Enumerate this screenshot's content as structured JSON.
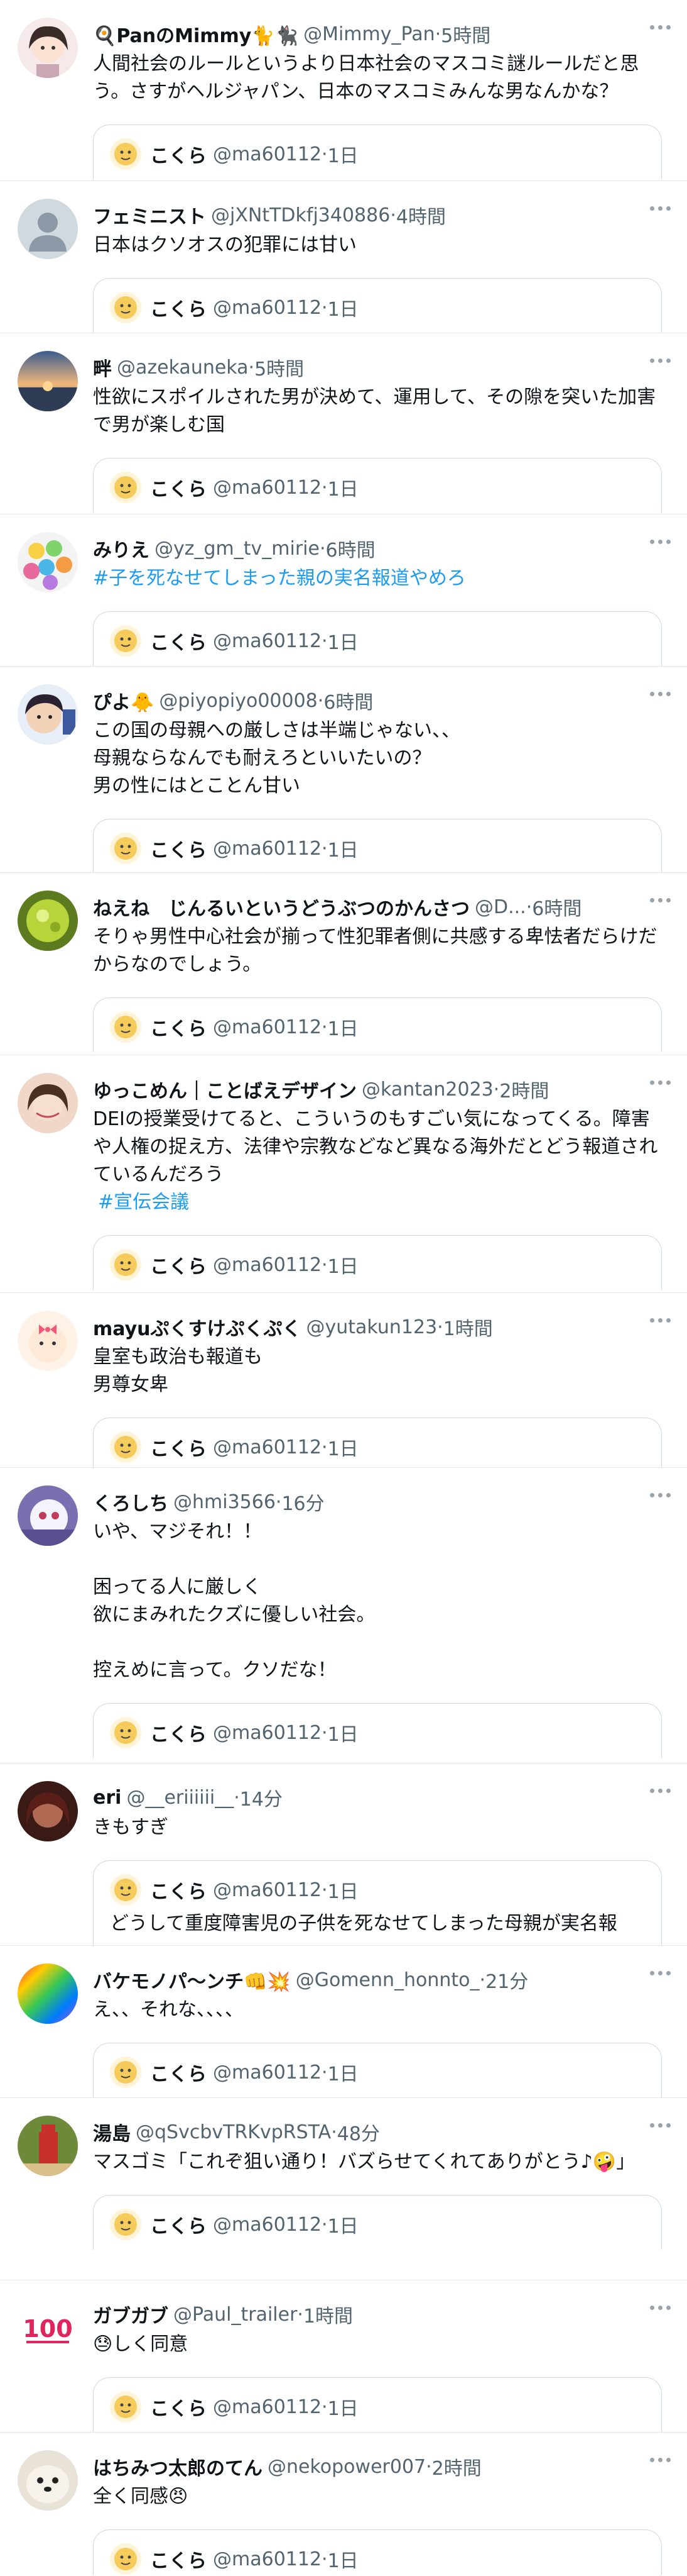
{
  "quoted": {
    "name": "こくら",
    "handle": "@ma60112",
    "time": "1日"
  },
  "tweets": [
    {
      "name": "🍳PanのMimmy🐈🐈‍⬛",
      "handle": "@Mimmy_Pan",
      "time": "5時間",
      "text": "人間社会のルールというより日本社会のマスコミ謎ルールだと思う。さすがヘルジャパン、日本のマスコミみんな男なんかな？"
    },
    {
      "name": "フェミニスト",
      "handle": "@jXNtTDkfj340886",
      "time": "4時間",
      "text": "日本はクソオスの犯罪には甘い"
    },
    {
      "name": "畔",
      "handle": "@azekauneka",
      "time": "5時間",
      "text": "性欲にスポイルされた男が決めて、運用して、その隙を突いた加害で男が楽しむ国"
    },
    {
      "name": "みりえ",
      "handle": "@yz_gm_tv_mirie",
      "time": "6時間",
      "hashtag": "#子を死なせてしまった親の実名報道やめろ"
    },
    {
      "name": "ぴよ🐥",
      "handle": "@piyopiyo00008",
      "time": "6時間",
      "text": "この国の母親への厳しさは半端じゃない、、\n母親ならなんでも耐えろといいたいの？\n男の性にはとことん甘い"
    },
    {
      "name": "ねえね　じんるいというどうぶつのかんさつ",
      "handle": "@D...",
      "time": "6時間",
      "text": "そりゃ男性中心社会が揃って性犯罪者側に共感する卑怯者だらけだからなのでしょう。"
    },
    {
      "name": "ゆっこめん｜ことばえデザイン",
      "handle": "@kantan2023",
      "time": "2時間",
      "text": "DEIの授業受けてると、こういうのもすごい気になってくる。障害や人権の捉え方、法律や宗教などなど異なる海外だとどう報道されているんだろう",
      "hashtag": "#宣伝会議"
    },
    {
      "name": "mayuぷくすけぷくぷく",
      "handle": "@yutakun123",
      "time": "1時間",
      "text": "皇室も政治も報道も\n男尊女卑"
    },
    {
      "name": "くろしち",
      "handle": "@hmi3566",
      "time": "16分",
      "text": "いや、マジそれ！！\n\n困ってる人に厳しく\n欲にまみれたクズに優しい社会。\n\n控えめに言って。クソだな！"
    },
    {
      "name": "eri",
      "handle": "@__eriiiiii__",
      "time": "14分",
      "text": "きもすぎ",
      "quote_text": "どうして重度障害児の子供を死なせてしまった母親が実名報"
    },
    {
      "name": "バケモノパ〜ンチ👊💥",
      "handle": "@Gomenn_honnto_",
      "time": "21分",
      "text": "え、、それな、、、、"
    },
    {
      "name": "湯島",
      "handle": "@qSvcbvTRKvpRSTA",
      "time": "48分",
      "text": "マスゴミ「これぞ狙い通り！バズらせてくれてありがとう♪🤪」"
    },
    {
      "name": "ガブガブ",
      "handle": "@Paul_trailer",
      "time": "1時間",
      "text": "😓しく同意"
    },
    {
      "name": "はちみつ太郎のてん",
      "handle": "@nekopower007",
      "time": "2時間",
      "text": "全く同感😠"
    }
  ],
  "colors": {
    "link": "#1d9bf0",
    "meta": "#536471",
    "divider": "#e1e6ea"
  }
}
